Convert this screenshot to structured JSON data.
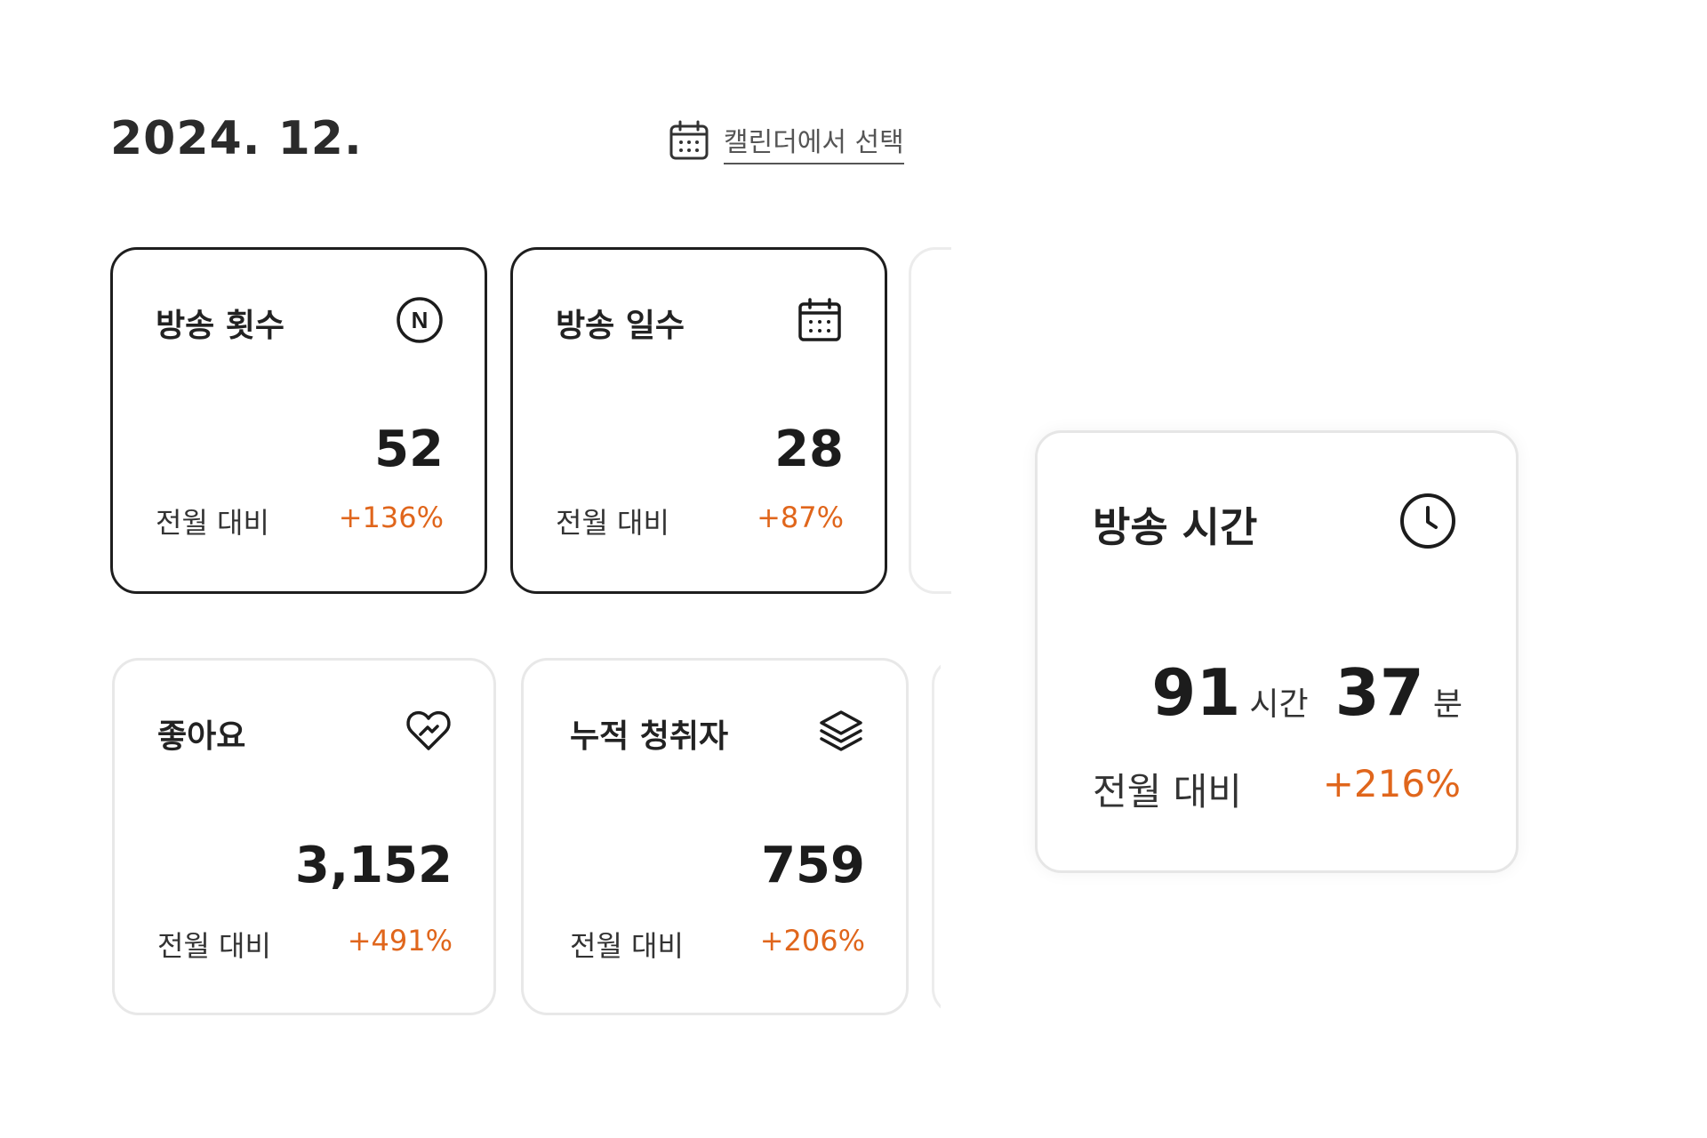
{
  "header": {
    "title": "2024. 12.",
    "calendar_label": "캘린더에서 선택",
    "calendar_icon": "calendar-icon"
  },
  "accent_color": "#e0661c",
  "cards": {
    "broadcast_count": {
      "title": "방송 횟수",
      "icon": "n-badge-icon",
      "value": "52",
      "compare_label": "전월 대비",
      "compare_value": "+136%"
    },
    "broadcast_days": {
      "title": "방송 일수",
      "icon": "calendar-icon",
      "value": "28",
      "compare_label": "전월 대비",
      "compare_value": "+87%"
    },
    "likes": {
      "title": "좋아요",
      "icon": "heart-icon",
      "value": "3,152",
      "compare_label": "전월 대비",
      "compare_value": "+491%"
    },
    "cumulative_viewers": {
      "title": "누적 청취자",
      "icon": "layers-icon",
      "value": "759",
      "compare_label": "전월 대비",
      "compare_value": "+206%"
    },
    "broadcast_time": {
      "title": "방송 시간",
      "icon": "clock-icon",
      "hours": "91",
      "hours_unit": "시간",
      "minutes": "37",
      "minutes_unit": "분",
      "compare_label": "전월 대비",
      "compare_value": "+216%"
    }
  }
}
